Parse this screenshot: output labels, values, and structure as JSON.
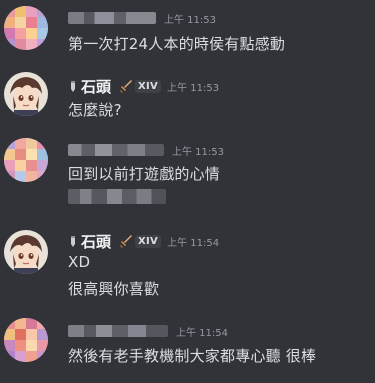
{
  "messages": [
    {
      "author": "",
      "time": "上午 11:53",
      "lines": [
        "第一次打24人本的時侯有點感動"
      ]
    },
    {
      "author": "石頭",
      "role_tag": "XIV",
      "time": "上午 11:53",
      "lines": [
        "怎麼說?"
      ]
    },
    {
      "author": "",
      "time": "上午 11:53",
      "lines": [
        "回到以前打遊戲的心情"
      ]
    },
    {
      "author": "石頭",
      "role_tag": "XIV",
      "time": "上午 11:54",
      "lines": [
        "XD",
        "很高興你喜歡"
      ]
    },
    {
      "author": "",
      "time": "上午 11:54",
      "lines": [
        "然後有老手教機制大家都專心聽  很棒"
      ]
    }
  ],
  "colors": {
    "background": "#313338",
    "text": "#dbdee1",
    "username": "#f2f3f5",
    "timestamp": "#949ba4",
    "role_tag_bg": "#3f4147"
  },
  "icons": {
    "pencil_badge": "pencil-icon",
    "role_icon": "sword-icon"
  }
}
